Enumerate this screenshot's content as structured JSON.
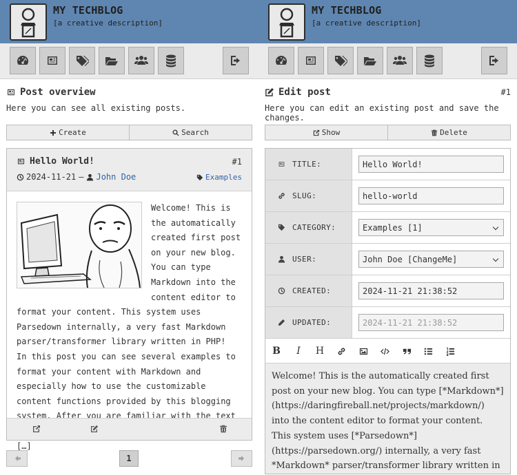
{
  "site": {
    "title": "MY TECHBLOG",
    "description": "[a creative description]"
  },
  "nav": {
    "items": [
      {
        "icon": "dashboard-icon"
      },
      {
        "icon": "newspaper-icon"
      },
      {
        "icon": "tags-icon"
      },
      {
        "icon": "folder-open-icon"
      },
      {
        "icon": "users-icon"
      },
      {
        "icon": "database-icon"
      }
    ],
    "logout_icon": "logout-icon"
  },
  "left": {
    "section_title": "Post overview",
    "section_desc": "Here you can see all existing posts.",
    "actions": {
      "create": "Create",
      "search": "Search"
    },
    "post": {
      "title": "Hello World!",
      "id": "#1",
      "date": "2024-11-21",
      "separator": "–",
      "author": "John Doe",
      "category": "Examples",
      "body": "Welcome! This is the automatically created first post on your new blog. You can type Markdown into the content editor to format your content. This system uses Parsedown internally, a very fast Markdown parser/transformer library written in PHP!",
      "body2": "In this post you can see several examples to format your content with Markdown and especially how to use the customizable content functions provided by this blogging system. After you are familiar with the text formatting and done with the exploration of […]"
    },
    "pagination": {
      "current": "1"
    }
  },
  "right": {
    "section_title": "Edit post",
    "section_id": "#1",
    "section_desc": "Here you can edit an existing post and save the changes.",
    "actions": {
      "show": "Show",
      "delete": "Delete"
    },
    "fields": {
      "title_label": "TITLE:",
      "title_value": "Hello World!",
      "slug_label": "SLUG:",
      "slug_value": "hello-world",
      "category_label": "CATEGORY:",
      "category_value": "Examples [1]",
      "user_label": "USER:",
      "user_value": "John Doe [ChangeMe]",
      "created_label": "CREATED:",
      "created_value": "2024-11-21 21:38:52",
      "updated_label": "UPDATED:",
      "updated_value": "2024-11-21 21:38:52"
    },
    "toolbar": {
      "bold": "B",
      "italic": "I",
      "heading": "H"
    },
    "editor_content": "Welcome! This is the automatically created first post on your new blog. You can type [*Markdown*](https://daringfireball.net/projects/markdown/) into the content editor to format your content. This system uses [*Parsedown*](https://parsedown.org/) internally, a very fast *Markdown* parser/transformer library written in PHP!"
  }
}
